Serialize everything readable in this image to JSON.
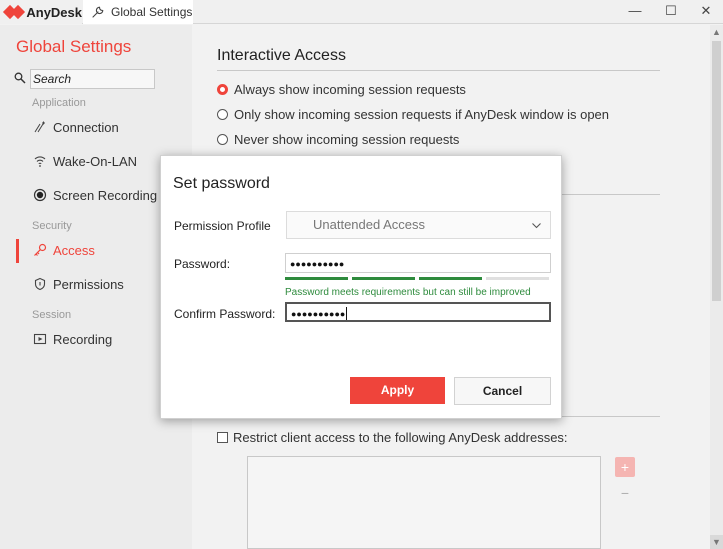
{
  "titlebar": {
    "app_name": "AnyDesk",
    "tab_label": "Global Settings",
    "minimize": "—",
    "maximize": "☐",
    "close": "✕"
  },
  "sidebar": {
    "title": "Global Settings",
    "search_value": "Search",
    "sections": {
      "application": "Application",
      "security": "Security",
      "session": "Session"
    },
    "items": [
      {
        "label": "Connection",
        "icon": "connection-icon"
      },
      {
        "label": "Wake-On-LAN",
        "icon": "wifi-icon"
      },
      {
        "label": "Screen Recording",
        "icon": "record-icon"
      },
      {
        "label": "Access",
        "icon": "key-icon",
        "active": true
      },
      {
        "label": "Permissions",
        "icon": "shield-icon"
      },
      {
        "label": "Recording",
        "icon": "recording-icon"
      }
    ]
  },
  "main": {
    "heading": "Interactive Access",
    "radios": [
      {
        "label": "Always show incoming session requests",
        "selected": true
      },
      {
        "label": "Only show incoming session requests if AnyDesk window is open",
        "selected": false
      },
      {
        "label": "Never show incoming session requests",
        "selected": false
      }
    ],
    "restrict_label": "Restrict client access to the following AnyDesk addresses:",
    "restrict_checked": false,
    "add_label": "+",
    "remove_label": "−"
  },
  "dialog": {
    "title": "Set password",
    "profile_label": "Permission Profile",
    "profile_value": "Unattended Access",
    "password_label": "Password:",
    "password_value": "●●●●●●●●●●",
    "strength_segments_filled": 3,
    "strength_segments_total": 4,
    "strength_message": "Password meets requirements but can still be improved",
    "confirm_label": "Confirm Password:",
    "confirm_value": "●●●●●●●●●●",
    "apply_label": "Apply",
    "cancel_label": "Cancel"
  },
  "colors": {
    "accent": "#ef443b",
    "strength_good": "#2e8b3d",
    "strength_empty": "#e0e0e0"
  }
}
